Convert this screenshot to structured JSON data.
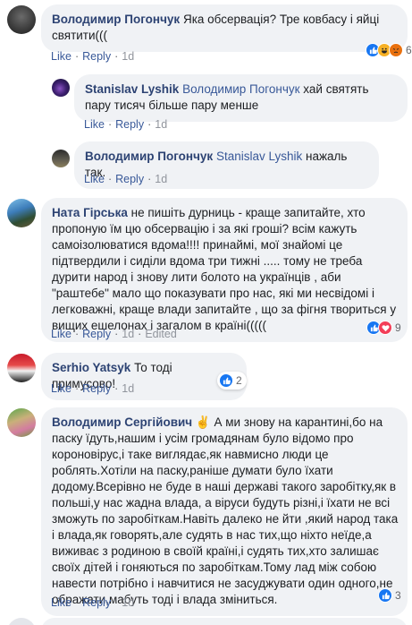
{
  "comments": [
    {
      "author": "Володимир Погончук",
      "text": "Яка обсервація? Тре ковбасу і яйці святити(((",
      "actions": {
        "like": "Like",
        "reply": "Reply",
        "time": "1d",
        "edited": ""
      },
      "reactions": {
        "icons": [
          "like-icon",
          "haha-icon",
          "angry-icon"
        ],
        "count": "6"
      }
    },
    {
      "author": "Stanislav Lyshik",
      "mention": "Володимир Погончук",
      "text": "хай святять пару тисяч більше пару менше",
      "actions": {
        "like": "Like",
        "reply": "Reply",
        "time": "1d",
        "edited": ""
      }
    },
    {
      "author": "Володимир Погончук",
      "mention": "Stanislav Lyshik",
      "text": "нажаль так.",
      "actions": {
        "like": "Like",
        "reply": "Reply",
        "time": "1d",
        "edited": ""
      }
    },
    {
      "author": "Ната Гірська",
      "text": "не пишіть дурниць - краще запитайте, хто пропоную їм цю обсервацію і за які гроші? всім кажуть самоізолюватися вдома!!!! принаймі, мої знайомі це підтвердили і сиділи вдома три тижні ..... тому не треба дурити народ і знову лити болото на українців , аби \"раштебе\" мало що показувати про нас, які ми несвідомі і легковажні, краще влади запитайте , що за фігня твориться у вищих ешелонах і загалом в країні(((((",
      "actions": {
        "like": "Like",
        "reply": "Reply",
        "time": "1d",
        "edited": "Edited"
      },
      "reactions": {
        "icons": [
          "like-icon",
          "love-icon"
        ],
        "count": "9"
      }
    },
    {
      "author": "Serhio Yatsyk",
      "text": "То тоді примусово!",
      "actions": {
        "like": "Like",
        "reply": "Reply",
        "time": "1d",
        "edited": ""
      },
      "reactions": {
        "icons": [
          "like-icon"
        ],
        "count": "2"
      }
    },
    {
      "author": "Володимир Сергійович",
      "badge": "✌",
      "text": "А ми знову на карантині,бо на паску їдуть,нашим і усім громадянам було відомо про короновірус,і таке виглядає,як навмисно люди це роблять.Хотіли на паску,раніше думати було їхати додому.Всерівно не буде в наші державі такого заробітку,як в польші,у нас жадна влада, а віруси будуть різні,і їхати не всі зможуть по заробіткам.Навіть далеко не йти ,який народ така і влада,як говорять,але судять в нас тих,що ніхто неїде,а виживає з родиною в своїй країні,і судять тих,хто залишає своїх дітей і гоняються по заробіткам.Тому лад між собою навести потрібно і навчитися не засуджувати один одного,не ображати,мабуть тоді і влада зміниться.",
      "actions": {
        "like": "Like",
        "reply": "Reply",
        "time": "1d",
        "edited": ""
      },
      "reactions": {
        "icons": [
          "like-icon"
        ],
        "count": "3"
      }
    }
  ],
  "colors": {
    "link": "#385898",
    "author": "#2d4373",
    "bubble": "#f0f2f5",
    "like": "#1877f2"
  }
}
